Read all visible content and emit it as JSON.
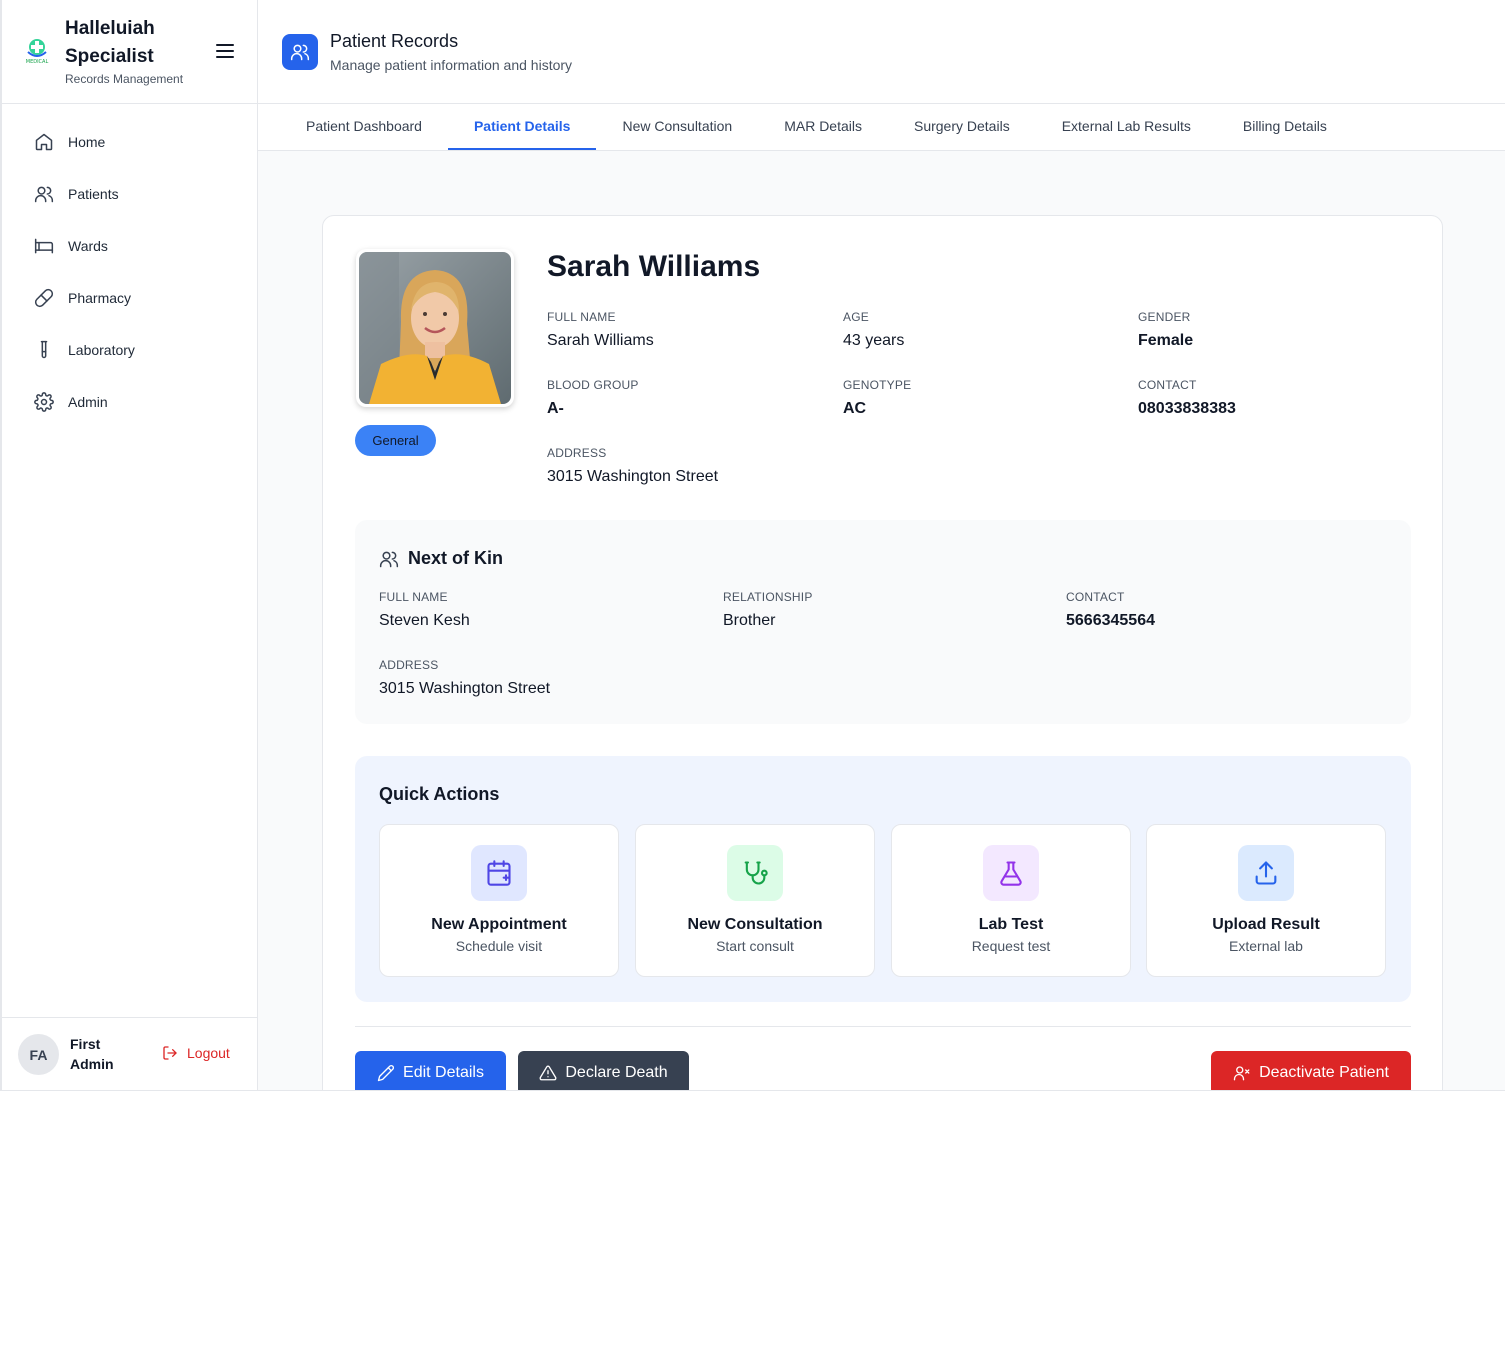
{
  "app": {
    "brand_title": "Halleluiah Specialist",
    "brand_subtitle": "Records Management",
    "logo_text": "MEDICAL"
  },
  "sidebar": {
    "items": [
      {
        "label": "Home",
        "icon": "home-icon"
      },
      {
        "label": "Patients",
        "icon": "users-icon"
      },
      {
        "label": "Wards",
        "icon": "bed-icon"
      },
      {
        "label": "Pharmacy",
        "icon": "pill-icon"
      },
      {
        "label": "Laboratory",
        "icon": "test-tube-icon"
      },
      {
        "label": "Admin",
        "icon": "gear-icon"
      }
    ],
    "user": {
      "initials": "FA",
      "name": "First Admin"
    },
    "logout_label": "Logout"
  },
  "header": {
    "title": "Patient Records",
    "subtitle": "Manage patient information and history"
  },
  "tabs": [
    {
      "label": "Patient Dashboard",
      "active": false
    },
    {
      "label": "Patient Details",
      "active": true
    },
    {
      "label": "New Consultation",
      "active": false
    },
    {
      "label": "MAR Details",
      "active": false
    },
    {
      "label": "Surgery Details",
      "active": false
    },
    {
      "label": "External Lab Results",
      "active": false
    },
    {
      "label": "Billing Details",
      "active": false
    }
  ],
  "patient": {
    "name": "Sarah Williams",
    "category_badge": "General",
    "fields": {
      "full_name": {
        "label": "FULL NAME",
        "value": "Sarah Williams"
      },
      "age": {
        "label": "AGE",
        "value": "43 years"
      },
      "gender": {
        "label": "GENDER",
        "value": "Female"
      },
      "blood_group": {
        "label": "BLOOD GROUP",
        "value": "A-"
      },
      "genotype": {
        "label": "GENOTYPE",
        "value": "AC"
      },
      "contact": {
        "label": "CONTACT",
        "value": "08033838383"
      },
      "address": {
        "label": "ADDRESS",
        "value": "3015 Washington Street"
      }
    }
  },
  "next_of_kin": {
    "title": "Next of Kin",
    "full_name": {
      "label": "FULL NAME",
      "value": "Steven Kesh"
    },
    "relationship": {
      "label": "RELATIONSHIP",
      "value": "Brother"
    },
    "contact": {
      "label": "CONTACT",
      "value": "5666345564"
    },
    "address": {
      "label": "ADDRESS",
      "value": "3015 Washington Street"
    }
  },
  "quick_actions": {
    "title": "Quick Actions",
    "items": [
      {
        "label": "New Appointment",
        "sub": "Schedule visit",
        "icon": "calendar-plus-icon",
        "color": "#4f46e5",
        "bg": "#e0e7ff"
      },
      {
        "label": "New Consultation",
        "sub": "Start consult",
        "icon": "stethoscope-icon",
        "color": "#16a34a",
        "bg": "#dcfce7"
      },
      {
        "label": "Lab Test",
        "sub": "Request test",
        "icon": "flask-icon",
        "color": "#9333ea",
        "bg": "#f3e8ff"
      },
      {
        "label": "Upload Result",
        "sub": "External lab",
        "icon": "upload-icon",
        "color": "#2563eb",
        "bg": "#dbeafe"
      }
    ]
  },
  "actions": {
    "edit_label": "Edit Details",
    "death_label": "Declare Death",
    "deactivate_label": "Deactivate Patient"
  },
  "colors": {
    "primary": "#2563eb",
    "danger": "#dc2626",
    "dark": "#374151"
  }
}
